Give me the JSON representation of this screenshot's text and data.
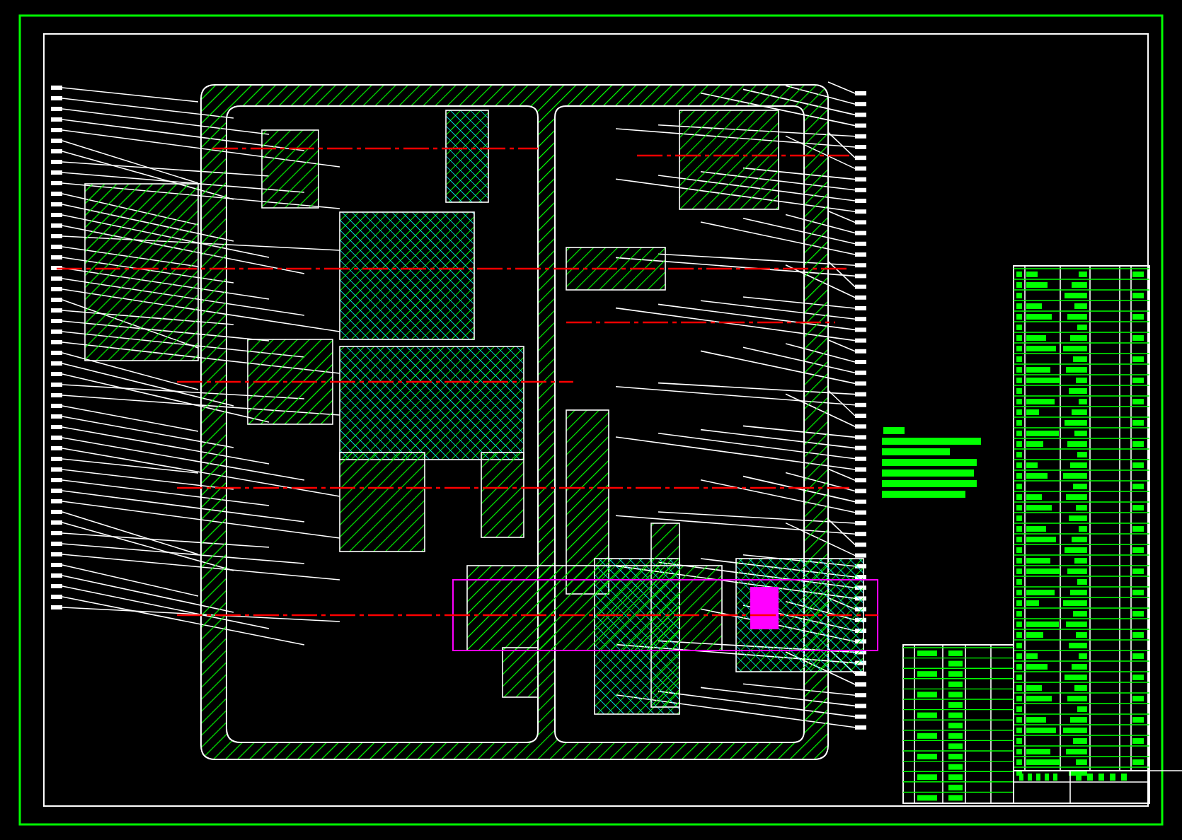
{
  "sheet": {
    "kind": "gearbox-assembly"
  }
}
